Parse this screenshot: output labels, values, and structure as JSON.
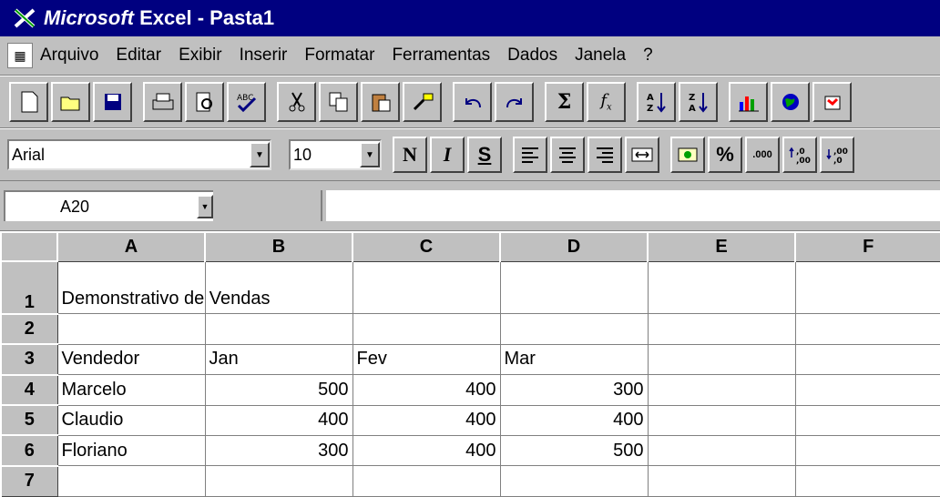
{
  "window": {
    "title_brand": "Microsoft",
    "title_rest": " Excel - Pasta1",
    "app_icon": "excel-x-icon"
  },
  "menu": {
    "items": [
      "Arquivo",
      "Editar",
      "Exibir",
      "Inserir",
      "Formatar",
      "Ferramentas",
      "Dados",
      "Janela",
      "?"
    ]
  },
  "toolbar": {
    "icons": [
      "new-icon",
      "open-icon",
      "save-icon",
      "print-icon",
      "print-preview-icon",
      "spelling-icon",
      "cut-icon",
      "copy-icon",
      "paste-icon",
      "format-painter-icon",
      "undo-icon",
      "redo-icon",
      "autosum-icon",
      "function-icon",
      "sort-ascending-icon",
      "sort-descending-icon",
      "chart-wizard-icon",
      "web-icon",
      "map-icon"
    ]
  },
  "format": {
    "font_name": "Arial",
    "font_size": "10",
    "bold_label": "N",
    "italic_label": "I",
    "underline_label": "S",
    "percent_label": "%",
    "comma_label": ".000"
  },
  "formula": {
    "name_box": "A20",
    "content": ""
  },
  "sheet": {
    "columns": [
      "A",
      "B",
      "C",
      "D",
      "E",
      "F"
    ],
    "rows": [
      {
        "num": "1",
        "cells": [
          "Demonstrativo de Vendas",
          "",
          "",
          "",
          "",
          ""
        ]
      },
      {
        "num": "2",
        "cells": [
          "",
          "",
          "",
          "",
          "",
          ""
        ]
      },
      {
        "num": "3",
        "cells": [
          "Vendedor",
          "Jan",
          "Fev",
          "Mar",
          "",
          ""
        ]
      },
      {
        "num": "4",
        "cells": [
          "Marcelo",
          "500",
          "400",
          "300",
          "",
          ""
        ]
      },
      {
        "num": "5",
        "cells": [
          "Claudio",
          "400",
          "400",
          "400",
          "",
          ""
        ]
      },
      {
        "num": "6",
        "cells": [
          "Floriano",
          "300",
          "400",
          "500",
          "",
          ""
        ]
      },
      {
        "num": "7",
        "cells": [
          "",
          "",
          "",
          "",
          "",
          ""
        ]
      }
    ]
  }
}
